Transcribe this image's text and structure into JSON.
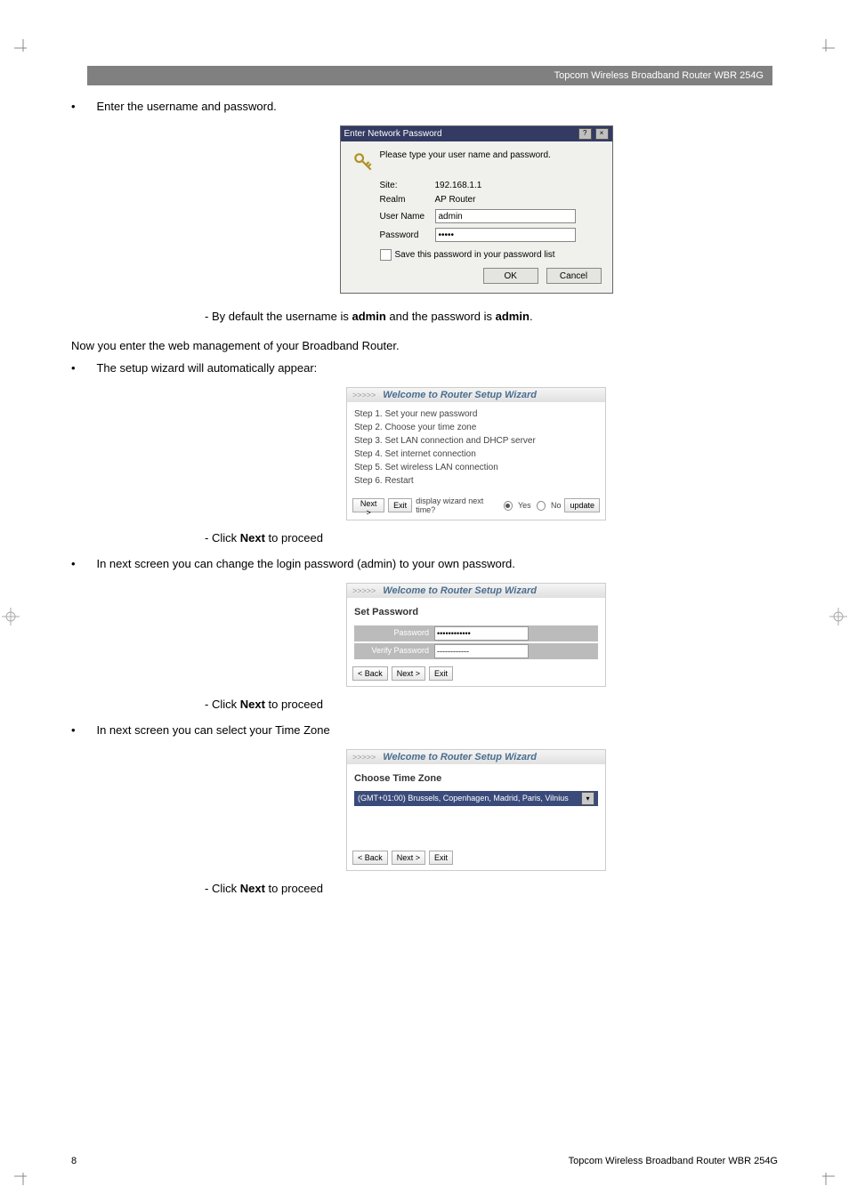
{
  "header": {
    "product": "Topcom Wireless Broadband Router WBR 254G"
  },
  "text": {
    "enter_credentials": "Enter the username and password.",
    "by_default": "- By default the username is ",
    "admin": "admin",
    "and_password": " and the password is ",
    "period": ".",
    "now_enter": "Now you enter the web management of your Broadband Router.",
    "setup_auto": "The setup wizard will automatically appear:",
    "click_next": "- Click ",
    "next": "Next",
    "to_proceed": " to proceed",
    "change_pw": "In next screen you can change the login password (admin) to your own password.",
    "select_tz": "In next screen you can select your Time Zone"
  },
  "dialog1": {
    "title": "Enter Network Password",
    "intro": "Please type your user name and password.",
    "site_label": "Site:",
    "site_value": "192.168.1.1",
    "realm_label": "Realm",
    "realm_value": "AP Router",
    "user_label": "User Name",
    "user_value": "admin",
    "pass_label": "Password",
    "pass_value": "•••••",
    "save_chk": "Save this password in your password list",
    "ok": "OK",
    "cancel": "Cancel"
  },
  "wizard_shared": {
    "breadcrumb": ">>>>>",
    "title": "Welcome to Router Setup Wizard",
    "next": "Next >",
    "back": "< Back",
    "exit": "Exit",
    "update": "update"
  },
  "wizard1": {
    "step1": "Step 1. Set your new password",
    "step2": "Step 2. Choose your time zone",
    "step3": "Step 3. Set LAN connection and DHCP server",
    "step4": "Step 4. Set internet connection",
    "step5": "Step 5. Set wireless LAN connection",
    "step6": "Step 6. Restart",
    "display_q": "display wizard next time?",
    "yes": "Yes",
    "no": "No"
  },
  "wizard2": {
    "heading": "Set Password",
    "pw_label": "Password",
    "vpw_label": "Verify Password",
    "pw_value": "••••••••••••",
    "vpw_value": "------------"
  },
  "wizard3": {
    "heading": "Choose Time Zone",
    "option": "(GMT+01:00) Brussels, Copenhagen, Madrid, Paris, Vilnius"
  },
  "footer": {
    "page": "8",
    "product": "Topcom Wireless Broadband Router WBR 254G"
  }
}
